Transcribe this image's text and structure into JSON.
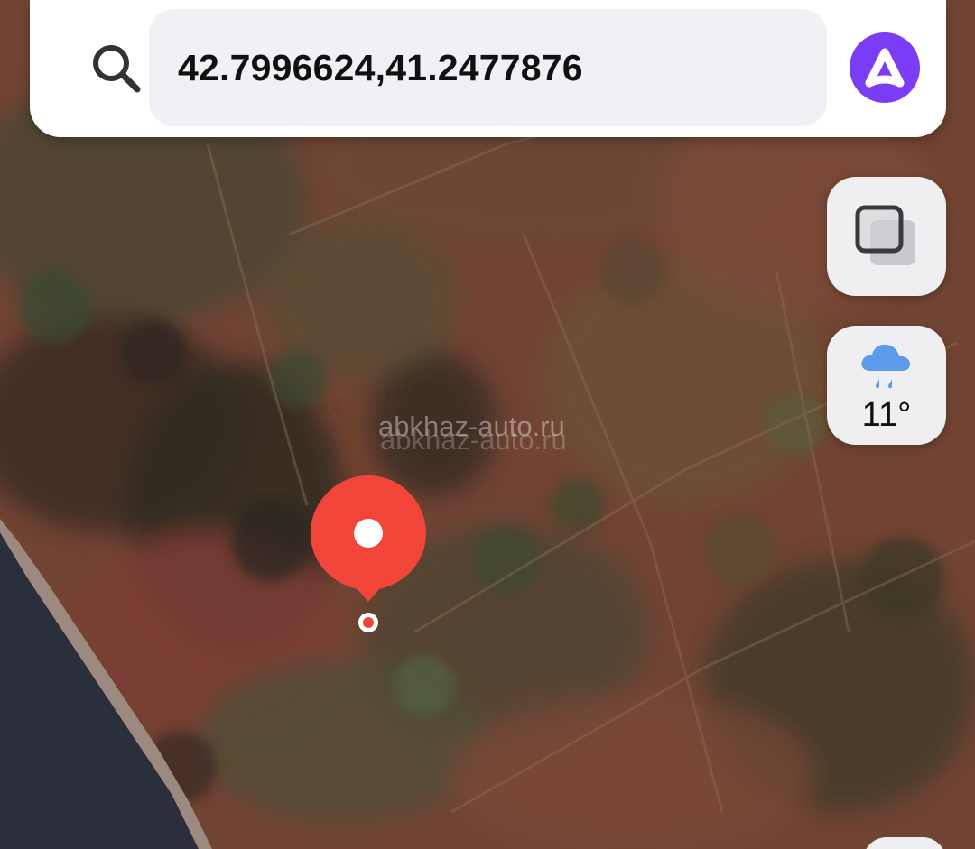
{
  "search": {
    "value": "42.7996624,41.2477876"
  },
  "weather": {
    "temperature": "11°",
    "icon": "rain-cloud-icon"
  },
  "watermark": {
    "text": "abkhaz-auto.ru"
  },
  "controls": {
    "layers_icon": "layers-icon",
    "assistant_icon": "alice-assistant-icon",
    "search_icon": "search-icon"
  },
  "marker": {
    "icon": "location-pin-icon",
    "color": "#f2453a"
  },
  "colors": {
    "accent": "#7a3cf5",
    "pin": "#f2453a",
    "water": "#2b2f3c",
    "shore": "#9c8a80"
  }
}
